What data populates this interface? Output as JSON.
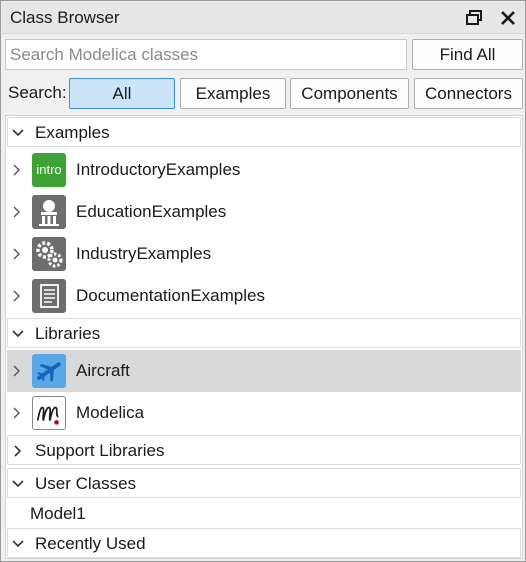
{
  "window": {
    "title": "Class Browser"
  },
  "search": {
    "placeholder": "Search Modelica classes",
    "value": "",
    "find_all_label": "Find All",
    "filter_label": "Search:",
    "filters": [
      "All",
      "Examples",
      "Components",
      "Connectors"
    ],
    "active_filter": "All"
  },
  "tree": {
    "sections": {
      "examples": "Examples",
      "libraries": "Libraries",
      "support": "Support Libraries",
      "user": "User Classes",
      "recent": "Recently Used"
    },
    "example_items": [
      {
        "label": "IntroductoryExamples",
        "icon": "intro-badge-icon",
        "icon_text": "intro"
      },
      {
        "label": "EducationExamples",
        "icon": "education-column-icon"
      },
      {
        "label": "IndustryExamples",
        "icon": "gears-icon"
      },
      {
        "label": "DocumentationExamples",
        "icon": "document-icon"
      }
    ],
    "library_items": [
      {
        "label": "Aircraft",
        "icon": "airplane-icon",
        "selected": true
      },
      {
        "label": "Modelica",
        "icon": "modelica-logo-icon"
      }
    ],
    "user_classes": [
      "Model1"
    ]
  },
  "colors": {
    "selection": "#d9d9d9",
    "active_filter_bg": "#cce4f7",
    "active_filter_border": "#3d8ee0",
    "intro_green": "#3ea335",
    "aircraft_blue": "#5aa7e8"
  }
}
